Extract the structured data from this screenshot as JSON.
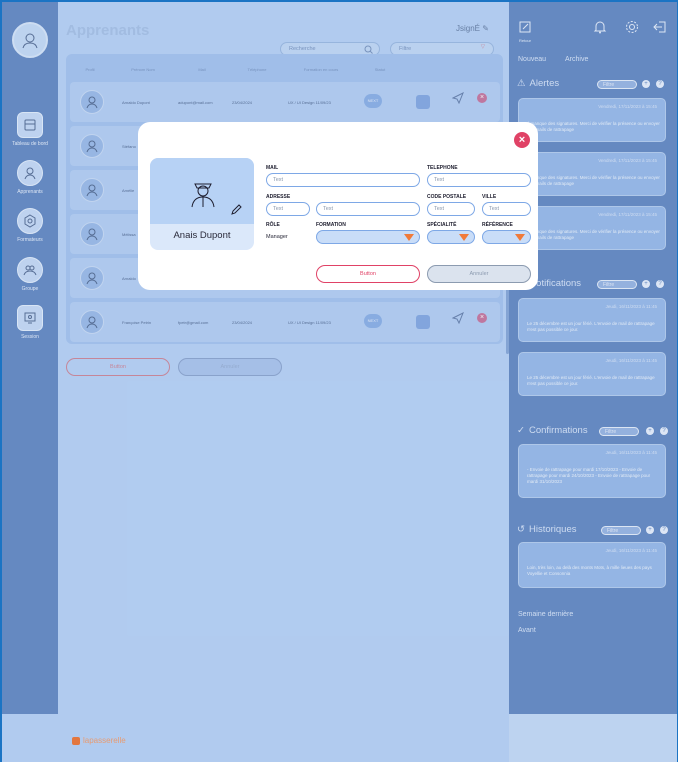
{
  "app": {
    "logo_text": "lapasserelle"
  },
  "sidebar": {
    "items": [
      {
        "label": "Tableau de bord",
        "icon": "dashboard-icon"
      },
      {
        "label": "Apprenants",
        "icon": "learner-icon"
      },
      {
        "label": "Formateurs",
        "icon": "trainer-icon"
      },
      {
        "label": "Groupe",
        "icon": "group-icon"
      },
      {
        "label": "Session",
        "icon": "session-icon"
      }
    ]
  },
  "main": {
    "title": "Apprenants",
    "user": "JsignÉ",
    "search_placeholder": "Recherche",
    "filter_label": "Filtre",
    "columns": [
      "Profil",
      "Prénom Nom",
      "Mail",
      "Téléphone",
      "Formation en cours",
      "Statut",
      ""
    ],
    "rows": [
      {
        "name": "Arnaldo Dupont",
        "mail": "adupont@mail.com",
        "phone": "23/04/2024",
        "formation": "UX / UI Design 11/09/23",
        "tag": "NEXT"
      },
      {
        "name": "Stéfano",
        "mail": "",
        "phone": "",
        "formation": "",
        "tag": ""
      },
      {
        "name": "Amélie",
        "mail": "",
        "phone": "",
        "formation": "",
        "tag": ""
      },
      {
        "name": "Mélissa",
        "mail": "",
        "phone": "",
        "formation": "",
        "tag": ""
      },
      {
        "name": "Arnaldo",
        "mail": "",
        "phone": "",
        "formation": "",
        "tag": ""
      },
      {
        "name": "Françoise Petrin",
        "mail": "fpetr@gmail.com",
        "phone": "23/04/2024",
        "formation": "UX / UI Design 11/09/23",
        "tag": "NEXT"
      }
    ],
    "btn_primary": "Button",
    "btn_secondary": "Annuler"
  },
  "right": {
    "top_icons": [
      {
        "label": "Retour",
        "icon": "edit-square-icon"
      },
      {
        "label": "",
        "icon": "bell-icon"
      },
      {
        "label": "",
        "icon": "gear-icon"
      },
      {
        "label": "",
        "icon": "logout-icon"
      }
    ],
    "links": [
      "Nouveau",
      "Archive"
    ],
    "sections": [
      {
        "title": "Alertes",
        "filter": "Filtre",
        "icon": "alert-icon",
        "cards": [
          {
            "date": "Vendredi, 17/11/2023  à 15:45",
            "sub": "",
            "body": "Il manque des signatures. Merci de vérifier la présence ou envoyer des mails de rattrapage"
          },
          {
            "date": "Vendredi, 17/11/2023  à 15:45",
            "sub": "",
            "body": "Il manque des signatures. Merci de vérifier la présence ou envoyer des mails de rattrapage"
          },
          {
            "date": "Vendredi, 17/11/2023  à 15:45",
            "sub": "",
            "body": "Il manque des signatures. Merci de vérifier la présence ou envoyer des mails de rattrapage"
          }
        ]
      },
      {
        "title": "Notifications",
        "filter": "Filtre",
        "icon": "notification-icon",
        "cards": [
          {
            "date": "Jeudi, 16/11/2023  à 11:45",
            "sub": "",
            "body": "Le 25 décembre est un jour férié. L'envoie de mail de rattrapage n'est pas possible ce jour."
          },
          {
            "date": "Jeudi, 16/11/2023  à 11:45",
            "sub": "",
            "body": "Le 25 décembre est un jour férié. L'envoie de mail de rattrapage n'est pas possible ce jour."
          }
        ]
      },
      {
        "title": "Confirmations",
        "filter": "Filtre",
        "icon": "check-circle-icon",
        "cards": [
          {
            "date": "Jeudi, 16/11/2023  à 11:45",
            "sub": "",
            "body": "- Envoie de rattrapage pour mardi 17/10/2023  - Envoie de rattrapage pour mardi 24/10/2023  - Envoie de rattrapage pour mardi 31/10/2023"
          }
        ]
      },
      {
        "title": "Historiques",
        "filter": "Filtre",
        "icon": "history-icon",
        "cards": [
          {
            "date": "Jeudi, 16/11/2023  à 11:45",
            "sub": "",
            "body": "Loin, très loin, au delà des monts Mots, à mille lieues des pays Voyellie et Consonnia"
          }
        ]
      }
    ],
    "week_links": [
      "Semaine dernière",
      "Avant"
    ]
  },
  "modal": {
    "name": "Anais Dupont",
    "labels": {
      "mail": "MAIL",
      "telephone": "TELEPHONE",
      "adresse": "ADRESSE",
      "code_postale": "CODE POSTALE",
      "ville": "VILLE",
      "role": "RÔLE",
      "formation": "FORMATION",
      "specialite": "SPÉCIALITÉ",
      "reference": "RÉFÉRENCE"
    },
    "placeholder": "Text",
    "role_value": "Manager",
    "btn_primary": "Button",
    "btn_secondary": "Annuler",
    "close": "×"
  }
}
